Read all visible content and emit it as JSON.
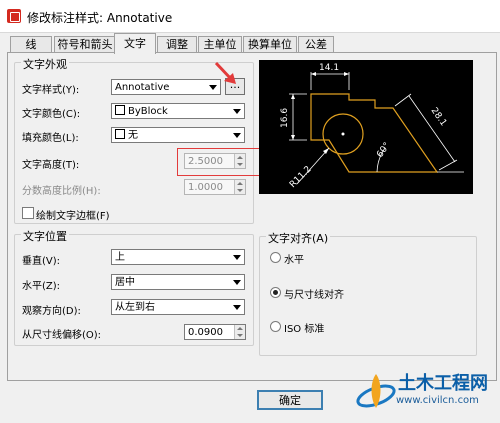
{
  "window": {
    "title": "修改标注样式: Annotative"
  },
  "tabs": [
    "线",
    "符号和箭头",
    "文字",
    "调整",
    "主单位",
    "换算单位",
    "公差"
  ],
  "text_appearance": {
    "group_title": "文字外观",
    "style_label": "文字样式(Y):",
    "style_value": "Annotative",
    "browse_label": "...",
    "color_label": "文字颜色(C):",
    "color_value": "ByBlock",
    "fill_label": "填充颜色(L):",
    "fill_value": "无",
    "height_label": "文字高度(T):",
    "height_value": "2.5000",
    "fraction_label": "分数高度比例(H):",
    "fraction_value": "1.0000",
    "frame_label": "绘制文字边框(F)"
  },
  "text_placement": {
    "group_title": "文字位置",
    "vertical_label": "垂直(V):",
    "vertical_value": "上",
    "horizontal_label": "水平(Z):",
    "horizontal_value": "居中",
    "view_label": "观察方向(D):",
    "view_value": "从左到右",
    "offset_label": "从尺寸线偏移(O):",
    "offset_value": "0.0900"
  },
  "text_alignment": {
    "group_title": "文字对齐(A)",
    "options": [
      "水平",
      "与尺寸线对齐",
      "ISO 标准"
    ],
    "selected": "与尺寸线对齐"
  },
  "preview": {
    "dims": [
      "14.1",
      "16.6",
      "28.1",
      "60°",
      "R11.2"
    ]
  },
  "buttons": {
    "ok": "确定"
  },
  "watermark": {
    "name": "土木工程网",
    "url": "www.civilcn.com"
  },
  "colors": {
    "preview_bg": "#000000",
    "preview_lines": "#ffffff",
    "preview_geometry": "#e0a020",
    "highlight": "#e23b3b"
  }
}
